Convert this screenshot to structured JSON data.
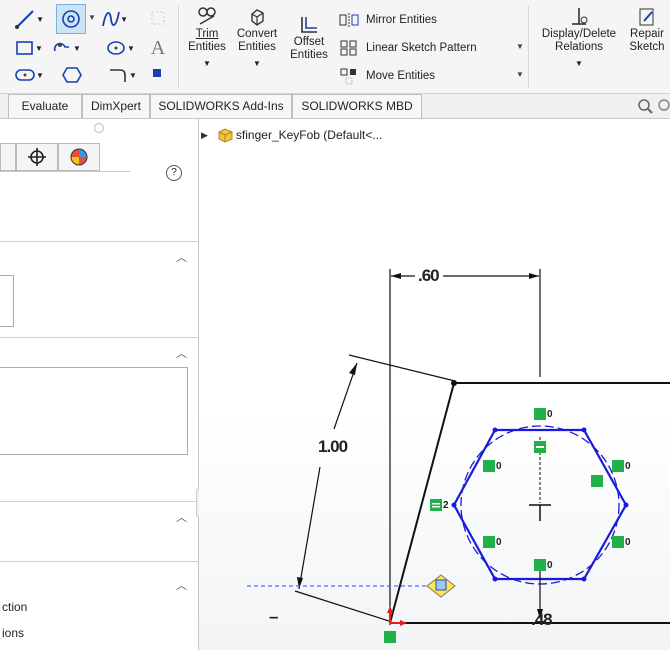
{
  "ribbon": {
    "trim_label": "Trim",
    "trim_label2": "Entities",
    "convert_label": "Convert",
    "convert_label2": "Entities",
    "offset_label": "Offset",
    "offset_label2": "Entities",
    "mirror_label": "Mirror Entities",
    "linear_pattern_label": "Linear Sketch Pattern",
    "move_label": "Move Entities",
    "relations_label": "Display/Delete",
    "relations_label2": "Relations",
    "repair_label": "Repair",
    "repair_label2": "Sketch"
  },
  "tabs": [
    "Evaluate",
    "DimXpert",
    "SOLIDWORKS Add-Ins",
    "SOLIDWORKS MBD"
  ],
  "panel": {
    "help_icon": "?",
    "list_item_1": "ction",
    "list_item_2": "ions"
  },
  "tree": {
    "part_name": "sfinger_KeyFob  (Default<..."
  },
  "sketch": {
    "dim_width": ".60",
    "dim_height": "1.00",
    "dim_bottom": ".48",
    "dim_minus": "–",
    "rel_labels": [
      "0",
      "0",
      "0",
      "0",
      "0",
      "0",
      "2"
    ]
  },
  "colors": {
    "sketch_blue": "#1a1adc",
    "relation_green": "#22b04a",
    "dimension_black": "#111111"
  }
}
